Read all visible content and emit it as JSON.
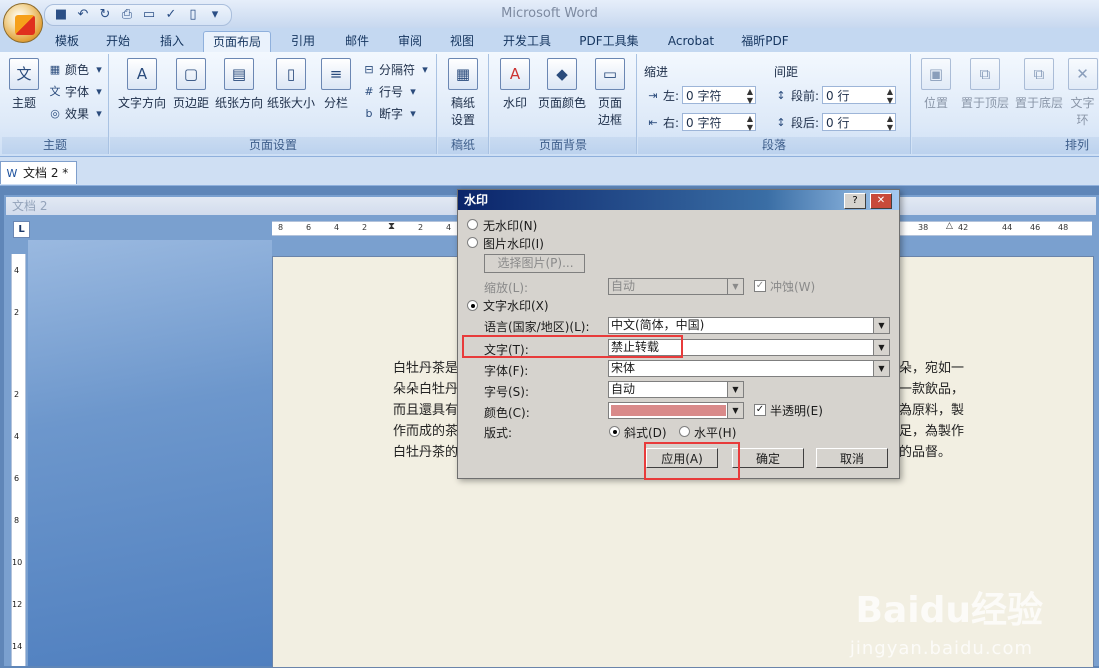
{
  "app": {
    "title": "Microsoft Word"
  },
  "ribbon": {
    "tabs": [
      "模板",
      "开始",
      "插入",
      "页面布局",
      "引用",
      "邮件",
      "审阅",
      "视图",
      "开发工具",
      "PDF工具集",
      "Acrobat",
      "福昕PDF"
    ],
    "active_tab": "页面布局",
    "groups": {
      "theme": {
        "label": "主题",
        "theme_btn": "主题",
        "colors": "颜色",
        "fonts": "字体",
        "effects": "效果"
      },
      "page_setup": {
        "label": "页面设置",
        "text_direction": "文字方向",
        "margins": "页边距",
        "orientation": "纸张方向",
        "size": "纸张大小",
        "columns": "分栏",
        "breaks": "分隔符",
        "line_numbers": "行号",
        "hyphenation": "断字"
      },
      "paper": {
        "label": "稿纸",
        "paper_setup": "稿纸设置"
      },
      "background": {
        "label": "页面背景",
        "watermark": "水印",
        "page_color": "页面颜色",
        "page_borders": "页面边框"
      },
      "paragraph": {
        "label": "段落",
        "indent_title": "缩进",
        "spacing_title": "间距",
        "left_label": "左:",
        "left_value": "0 字符",
        "right_label": "右:",
        "right_value": "0 字符",
        "before_label": "段前:",
        "before_value": "0 行",
        "after_label": "段后:",
        "after_value": "0 行"
      },
      "arrange": {
        "label": "排列",
        "position": "位置",
        "bring_front": "置于顶层",
        "send_back": "置于底层",
        "text_wrap": "文字环"
      }
    }
  },
  "document": {
    "tab_name": "文档 2 *",
    "window_caption": "文档 2",
    "ruler_h_left": [
      "8",
      "6",
      "4",
      "2",
      "2",
      "4"
    ],
    "ruler_h_right": [
      "38",
      "42",
      "44",
      "46",
      "48"
    ],
    "ruler_v": [
      "4",
      "2",
      "2",
      "4",
      "6",
      "8",
      "10",
      "12",
      "14"
    ],
    "text_left": [
      "白牡丹茶是",
      "朵朵白牡丹",
      "而且還具有",
      "作而成的茶",
      "白牡丹茶的"
    ],
    "text_right": [
      "朵，宛如一",
      "一款飲品，",
      "為原料，製",
      "足，為製作",
      "的品督。"
    ]
  },
  "dialog": {
    "title": "水印",
    "help_btn": "?",
    "close_btn": "✕",
    "no_watermark": "无水印(N)",
    "picture_watermark": "图片水印(I)",
    "select_picture": "选择图片(P)...",
    "scale_label": "缩放(L):",
    "scale_value": "自动",
    "washout_label": "冲蚀(W)",
    "text_watermark": "文字水印(X)",
    "language_label": "语言(国家/地区)(L):",
    "language_value": "中文(简体，中国)",
    "text_label": "文字(T):",
    "text_value": "禁止转载",
    "font_label": "字体(F):",
    "font_value": "宋体",
    "size_label": "字号(S):",
    "size_value": "自动",
    "color_label": "颜色(C):",
    "color_value": "#d98a8a",
    "semitransparent_label": "半透明(E)",
    "layout_label": "版式:",
    "diagonal_label": "斜式(D)",
    "horizontal_label": "水平(H)",
    "apply_btn": "应用(A)",
    "ok_btn": "确定",
    "cancel_btn": "取消"
  },
  "watermark_overlay": {
    "logo": "Baidu经验",
    "url": "jingyan.baidu.com"
  },
  "colors": {
    "highlight_red": "#e83b3b",
    "ribbon_blue": "#dde9f8"
  }
}
